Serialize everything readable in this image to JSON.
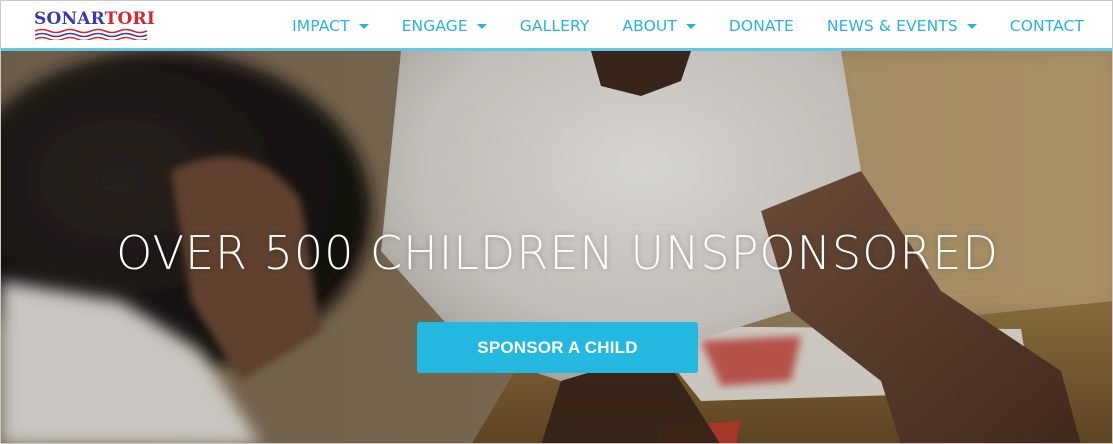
{
  "brand": {
    "logo_part1": "SONAR",
    "logo_part2": "TORI",
    "logo_alt": "SONARTORI",
    "primary_color": "#29b3dc",
    "logo_blue": "#3a3aa8",
    "logo_red": "#d8262e"
  },
  "nav": {
    "items": [
      {
        "label": "IMPACT",
        "has_dropdown": true
      },
      {
        "label": "ENGAGE",
        "has_dropdown": true
      },
      {
        "label": "GALLERY",
        "has_dropdown": false
      },
      {
        "label": "ABOUT",
        "has_dropdown": true
      },
      {
        "label": "DONATE",
        "has_dropdown": false
      },
      {
        "label": "NEWS & EVENTS",
        "has_dropdown": true
      },
      {
        "label": "CONTACT",
        "has_dropdown": false
      }
    ]
  },
  "hero": {
    "headline": "OVER 500 CHILDREN UNSPONSORED",
    "cta_label": "SPONSOR A CHILD",
    "cta_color": "#24b8e0"
  }
}
